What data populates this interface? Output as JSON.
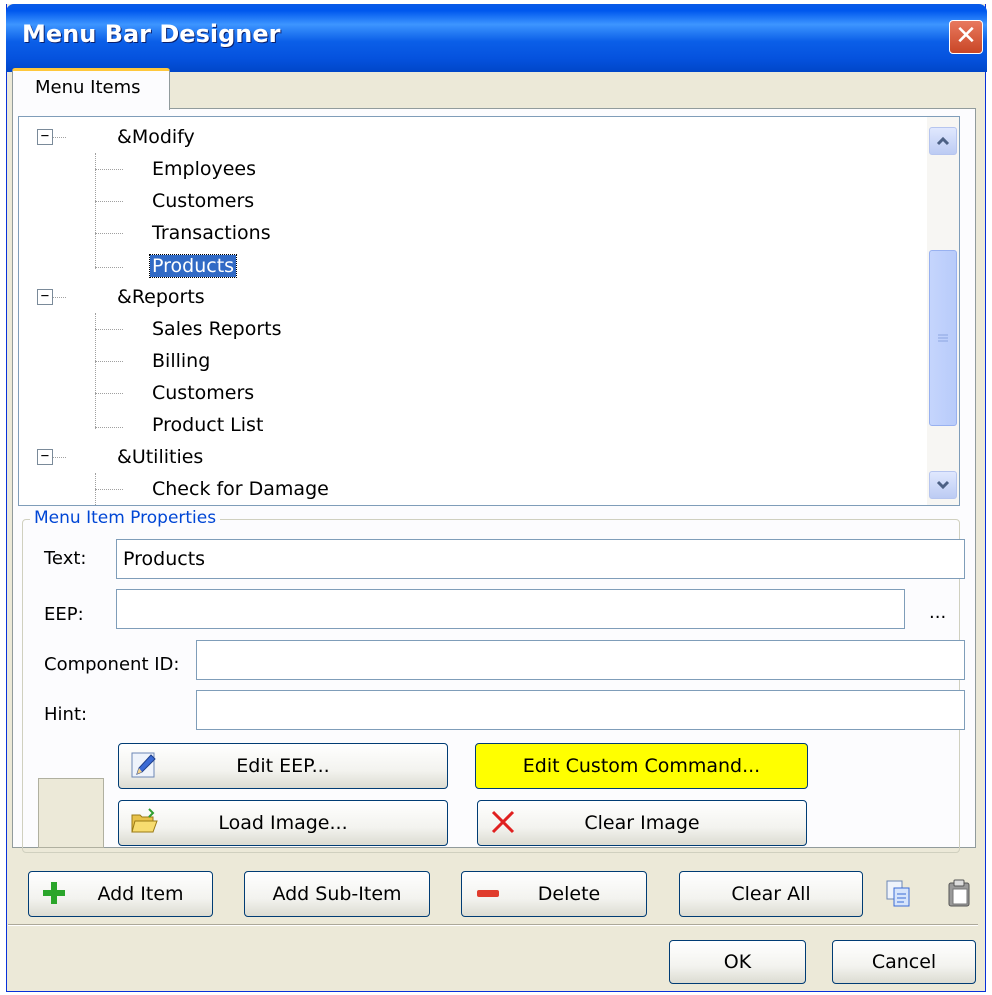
{
  "window": {
    "title": "Menu Bar Designer",
    "close_label": "✕"
  },
  "tabs": [
    {
      "label": "Menu Items"
    }
  ],
  "tree": {
    "nodes": [
      {
        "label": "&Modify",
        "level": 0,
        "expanded": true
      },
      {
        "label": "Employees",
        "level": 1
      },
      {
        "label": "Customers",
        "level": 1
      },
      {
        "label": "Transactions",
        "level": 1
      },
      {
        "label": "Products",
        "level": 1,
        "selected": true
      },
      {
        "label": "&Reports",
        "level": 0,
        "expanded": true
      },
      {
        "label": "Sales Reports",
        "level": 1
      },
      {
        "label": "Billing",
        "level": 1
      },
      {
        "label": "Customers",
        "level": 1
      },
      {
        "label": "Product List",
        "level": 1
      },
      {
        "label": "&Utilities",
        "level": 0,
        "expanded": true
      },
      {
        "label": "Check for Damage",
        "level": 1
      }
    ],
    "expander_symbol": "−"
  },
  "properties": {
    "legend": "Menu Item Properties",
    "text_label": "Text:",
    "text_value": "Products",
    "eep_label": "EEP:",
    "eep_value": "",
    "eep_browse": "...",
    "component_id_label": "Component ID:",
    "component_id_value": "",
    "hint_label": "Hint:",
    "hint_value": "",
    "edit_eep_button": "Edit EEP...",
    "edit_custom_command_button": "Edit Custom Command...",
    "load_image_button": "Load Image...",
    "clear_image_button": "Clear Image"
  },
  "actions": {
    "add_item": "Add Item",
    "add_sub_item": "Add Sub-Item",
    "delete": "Delete",
    "clear_all": "Clear All"
  },
  "dialog": {
    "ok": "OK",
    "cancel": "Cancel"
  },
  "colors": {
    "title_bar": "#0058ee",
    "selection": "#316ac5",
    "highlight_button": "#ffff00"
  }
}
